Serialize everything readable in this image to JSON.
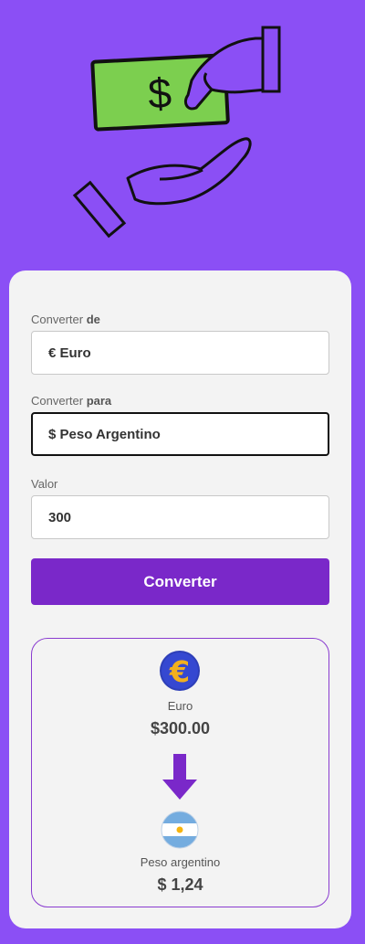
{
  "form": {
    "from_label_prefix": "Converter",
    "from_label_bold": "de",
    "from_value": "€ Euro",
    "to_label_prefix": "Converter",
    "to_label_bold": "para",
    "to_value": "$ Peso Argentino",
    "amount_label": "Valor",
    "amount_value": "300",
    "convert_button": "Converter"
  },
  "result": {
    "from_name": "Euro",
    "from_amount": "$300.00",
    "to_name": "Peso argentino",
    "to_amount": "$ 1,24"
  },
  "colors": {
    "background": "#8b4ff5",
    "accent": "#7a28c9",
    "card": "#f3f3f3"
  },
  "icons": [
    "money-exchange-illustration",
    "euro-coin-icon",
    "down-arrow-icon",
    "argentina-flag-icon"
  ]
}
